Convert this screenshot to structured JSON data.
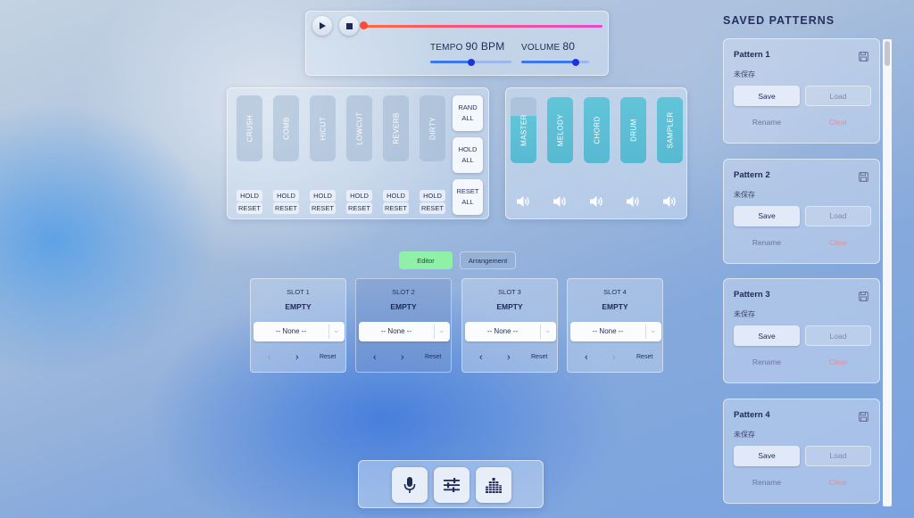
{
  "transport": {
    "play_icon": "play-icon",
    "stop_icon": "stop-icon",
    "progress": 0.0,
    "tempo": {
      "label": "TEMPO",
      "value": "90 BPM",
      "level": 0.5
    },
    "volume": {
      "label": "VOLUME",
      "value": "80",
      "level": 0.8
    }
  },
  "fx": {
    "items": [
      {
        "name": "CRUSH",
        "hold": "HOLD",
        "reset": "RESET"
      },
      {
        "name": "COMB",
        "hold": "HOLD",
        "reset": "RESET"
      },
      {
        "name": "HICUT",
        "hold": "HOLD",
        "reset": "RESET"
      },
      {
        "name": "LOWCUT",
        "hold": "HOLD",
        "reset": "RESET"
      },
      {
        "name": "REVERB",
        "hold": "HOLD",
        "reset": "RESET"
      },
      {
        "name": "DIRTY",
        "hold": "HOLD",
        "reset": "RESET"
      }
    ],
    "rand_all": "RAND ALL",
    "hold_all": "HOLD ALL",
    "reset_all": "RESET ALL"
  },
  "mixer": {
    "channels": [
      {
        "name": "MASTER",
        "level": 0.72,
        "icon": "speaker-icon"
      },
      {
        "name": "MELODY",
        "level": 1.0,
        "icon": "speaker-icon"
      },
      {
        "name": "CHORD",
        "level": 1.0,
        "icon": "speaker-icon"
      },
      {
        "name": "DRUM",
        "level": 1.0,
        "icon": "speaker-icon"
      },
      {
        "name": "SAMPLER",
        "level": 1.0,
        "icon": "speaker-icon"
      }
    ]
  },
  "tabs": {
    "editor": "Editor",
    "arrangement": "Arrangement",
    "active": "editor"
  },
  "slots": [
    {
      "title": "SLOT 1",
      "status": "EMPTY",
      "selected": "-- None --",
      "reset": "Reset"
    },
    {
      "title": "SLOT 2",
      "status": "EMPTY",
      "selected": "-- None --",
      "reset": "Reset"
    },
    {
      "title": "SLOT 3",
      "status": "EMPTY",
      "selected": "-- None --",
      "reset": "Reset"
    },
    {
      "title": "SLOT 4",
      "status": "EMPTY",
      "selected": "-- None --",
      "reset": "Reset"
    }
  ],
  "toolbar": {
    "icons": [
      "microphone-icon",
      "sliders-icon",
      "equalizer-icon"
    ]
  },
  "saved_patterns": {
    "title": "SAVED PATTERNS",
    "items": [
      {
        "name": "Pattern 1",
        "state": "未保存",
        "save": "Save",
        "load": "Load",
        "rename": "Rename",
        "clear": "Clear"
      },
      {
        "name": "Pattern 2",
        "state": "未保存",
        "save": "Save",
        "load": "Load",
        "rename": "Rename",
        "clear": "Clear"
      },
      {
        "name": "Pattern 3",
        "state": "未保存",
        "save": "Save",
        "load": "Load",
        "rename": "Rename",
        "clear": "Clear"
      },
      {
        "name": "Pattern 4",
        "state": "未保存",
        "save": "Save",
        "load": "Load",
        "rename": "Rename",
        "clear": "Clear"
      }
    ]
  },
  "colors": {
    "accent": "#1d35d8",
    "mixer_fill": "#5fc0d6",
    "clear_text": "#ee8a94",
    "editor_tab": "#8ff0a8"
  }
}
